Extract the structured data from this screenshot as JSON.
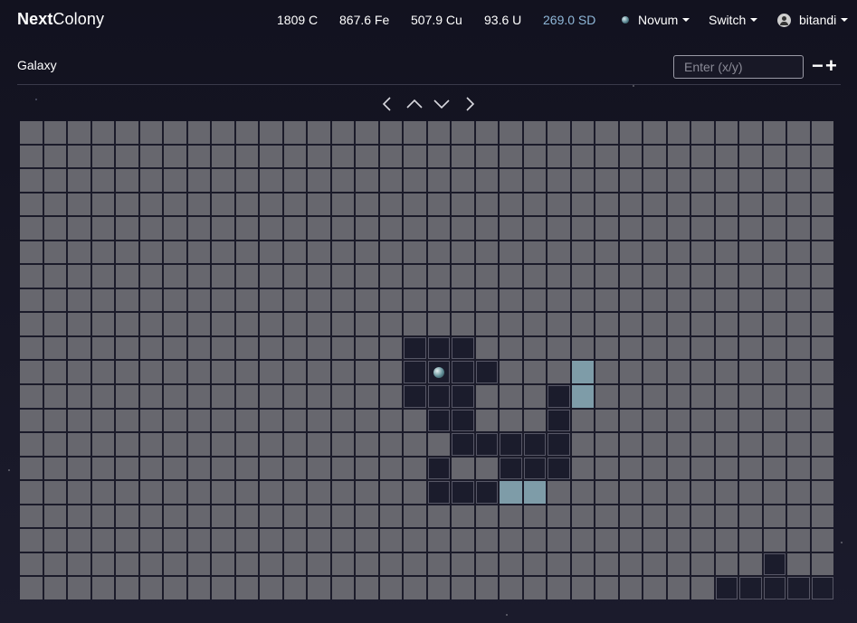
{
  "brand": {
    "bold": "Next",
    "rest": "Colony"
  },
  "resources": {
    "coal": "1809 C",
    "ore": "867.6 Fe",
    "copper": "507.9 Cu",
    "uranium": "93.6 U",
    "sd": "269.0 SD"
  },
  "nav": {
    "planet_label": "Novum",
    "switch_label": "Switch",
    "user_label": "bitandi"
  },
  "page": {
    "title": "Galaxy",
    "coord_placeholder": "Enter (x/y)",
    "zoom_out": "−",
    "zoom_in": "+"
  },
  "colors": {
    "sd": "#8fb7d8",
    "unexplored": "#7c7c82",
    "explored": "#1b1c2c",
    "highlight": "#7e9ca8"
  },
  "grid": {
    "cols": 34,
    "rows": 20,
    "explored": [
      [
        9,
        16
      ],
      [
        9,
        17
      ],
      [
        9,
        18
      ],
      [
        10,
        16
      ],
      [
        10,
        17
      ],
      [
        10,
        18
      ],
      [
        10,
        19
      ],
      [
        11,
        16
      ],
      [
        11,
        17
      ],
      [
        11,
        18
      ],
      [
        11,
        22
      ],
      [
        12,
        17
      ],
      [
        12,
        18
      ],
      [
        12,
        22
      ],
      [
        13,
        18
      ],
      [
        13,
        19
      ],
      [
        13,
        20
      ],
      [
        13,
        21
      ],
      [
        13,
        22
      ],
      [
        14,
        17
      ],
      [
        14,
        20
      ],
      [
        14,
        21
      ],
      [
        14,
        22
      ],
      [
        15,
        17
      ],
      [
        15,
        18
      ],
      [
        15,
        19
      ],
      [
        18,
        31
      ],
      [
        19,
        29
      ],
      [
        19,
        30
      ],
      [
        19,
        31
      ],
      [
        19,
        32
      ],
      [
        19,
        33
      ]
    ],
    "highlighted": [
      [
        10,
        23
      ],
      [
        11,
        23
      ],
      [
        15,
        20
      ],
      [
        15,
        21
      ]
    ],
    "planets": [
      [
        10,
        17
      ]
    ]
  }
}
